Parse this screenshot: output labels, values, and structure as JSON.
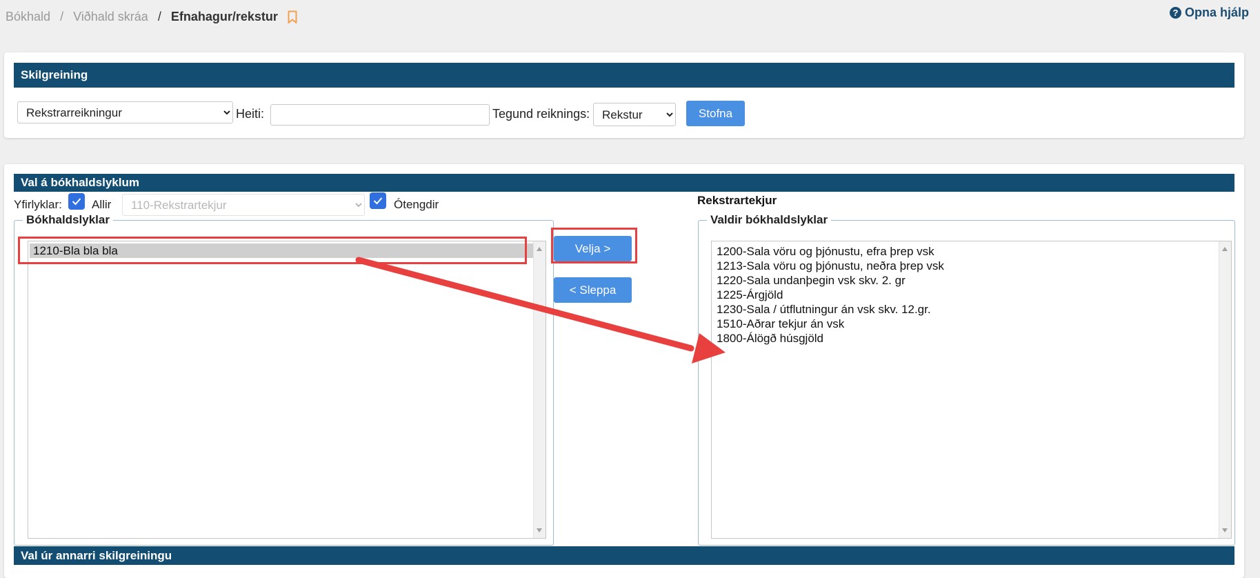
{
  "breadcrumb": {
    "items": [
      "Bókhald",
      "Viðhald skráa"
    ],
    "separator": "/",
    "current": "Efnahagur/rekstur"
  },
  "help": {
    "label": "Opna hjálp",
    "icon": "question-circle-icon"
  },
  "definition_panel": {
    "title": "Skilgreining",
    "statement_select": "Rekstrarreikningur",
    "name_label": "Heiti:",
    "name_value": "",
    "type_label": "Tegund reiknings:",
    "type_select": "Rekstur",
    "create_button": "Stofna"
  },
  "accounts_panel": {
    "title": "Val á bókhaldslyklum",
    "parent_label": "Yfirlyklar:",
    "all_label": "Allir",
    "all_checked": true,
    "parent_select": "110-Rekstrartekjur",
    "unlinked_label": "Ótengdir",
    "unlinked_checked": true,
    "group_heading": "Rekstrartekjur",
    "available": {
      "legend": "Bókhaldslyklar",
      "items": [
        "1210-Bla bla bla"
      ]
    },
    "select_button": "Velja >",
    "release_button": "< Sleppa",
    "selected": {
      "legend": "Valdir bókhaldslyklar",
      "items": [
        "1200-Sala vöru og þjónustu, efra þrep vsk",
        "1213-Sala vöru og þjónustu, neðra þrep vsk",
        "1220-Sala undanþegin vsk skv. 2. gr",
        "1225-Árgjöld",
        "1230-Sala / útflutningur án vsk skv. 12.gr.",
        "1510-Aðrar tekjur án vsk",
        "1800-Álögð húsgjöld"
      ]
    }
  },
  "other_panel": {
    "title": "Val úr annarri skilgreiningu"
  },
  "colors": {
    "header_bar": "#134d72",
    "button": "#4a90e2",
    "checkbox": "#2f6fe0",
    "annotation": "#e8403f",
    "bookmark": "#f0a050"
  }
}
